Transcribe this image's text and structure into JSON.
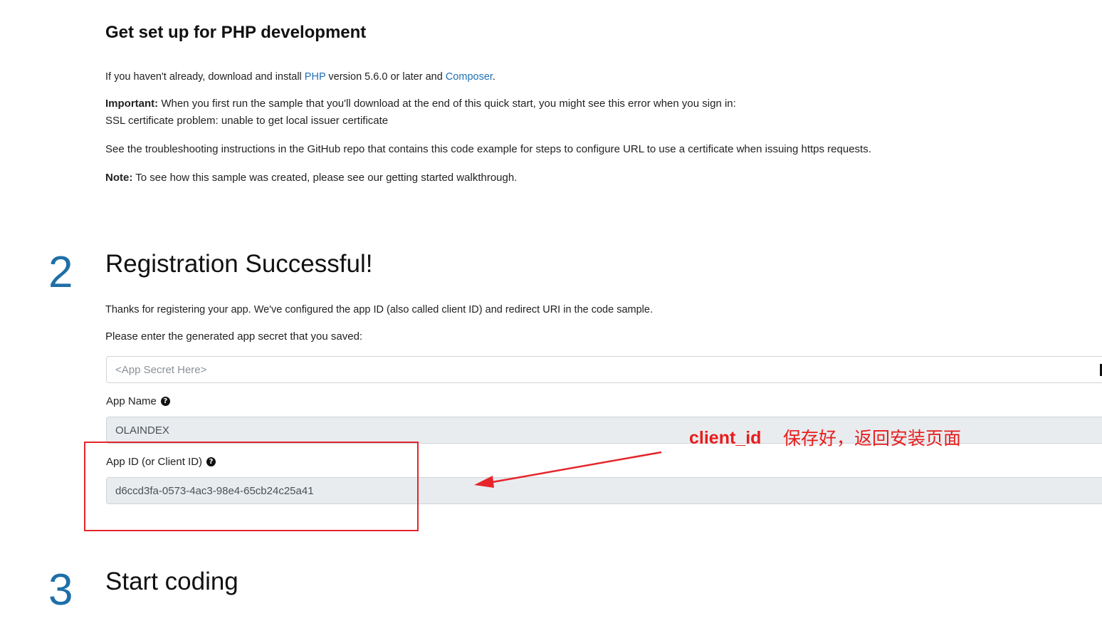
{
  "setup": {
    "title": "Get set up for PHP development",
    "install_prefix": "If you haven't already, download and install ",
    "php_link": "PHP",
    "install_middle": " version 5.6.0 or later and ",
    "composer_link": "Composer",
    "install_suffix": ".",
    "important_label": "Important:",
    "important_text": " When you first run the sample that you'll download at the end of this quick start, you might see this error when you sign in:",
    "ssl_error": "SSL certificate problem: unable to get local issuer certificate",
    "troubleshoot_text": "See the troubleshooting instructions in the GitHub repo that contains this code example for steps to configure URL to use a certificate when issuing https requests.",
    "note_label": "Note:",
    "note_text": " To see how this sample was created, please see our getting started walkthrough."
  },
  "step2": {
    "number": "2",
    "title": "Registration Successful!",
    "thanks_text": "Thanks for registering your app. We've configured the app ID (also called client ID) and redirect URI in the code sample.",
    "secret_prompt": "Please enter the generated app secret that you saved:",
    "secret_placeholder": "<App Secret Here>",
    "app_name_label": "App Name",
    "app_name_value": "OLAINDEX",
    "app_id_label": "App ID (or Client ID)",
    "app_id_value": "d6ccd3fa-0573-4ac3-98e4-65cb24c25a41",
    "help_icon": "question-circle-icon"
  },
  "step3": {
    "number": "3",
    "title": "Start coding"
  },
  "annotation": {
    "client_id_label": "client_id",
    "note": "保存好，返回安装页面",
    "color": "#e81c1c"
  }
}
